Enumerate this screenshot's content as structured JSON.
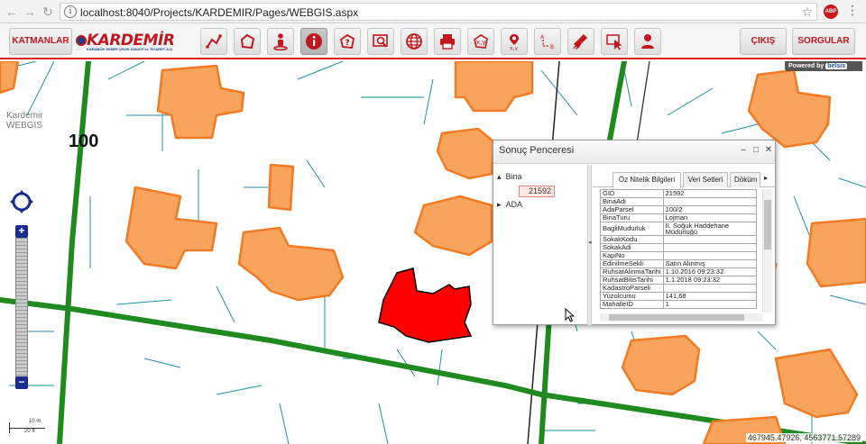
{
  "browser": {
    "url": "localhost:8040/Projects/KARDEMIR/Pages/WEBGIS.aspx",
    "abp_label": "ABP"
  },
  "toolbar": {
    "layers_label": "KATMANLAR",
    "logo_text": "KARDEMİR",
    "logo_subtitle": "KARABÜK DEMİR ÇELİK SANAYİ ve TİCARET A.Ş.",
    "exit_label": "ÇIKIŞ",
    "queries_label": "SORGULAR",
    "accent": "#c0181e"
  },
  "map": {
    "powered_prefix": "Powered by",
    "powered_brand": "belsis",
    "label_line1": "Kardemir",
    "label_line2": "WEBGIS",
    "scale_text": "100",
    "coords": "467945.47926, 4563771.57289",
    "scalebar_m": "10 m",
    "scalebar_ft": "20 ft",
    "building_fill": "#f9a45c",
    "selected_fill": "#ff0000",
    "road_color": "#1f8a1f"
  },
  "window": {
    "title": "Sonuç Penceresi",
    "tree_root": "Bina",
    "tree_selected": "21592",
    "tree_other": "ADA",
    "tabs": [
      "Öz Nitelik Bilgileri",
      "Veri Setleri",
      "Döküm"
    ],
    "rows": [
      [
        "GID",
        "21592"
      ],
      [
        "BinaAdi",
        ""
      ],
      [
        "AdaParsel",
        "100/2"
      ],
      [
        "BinaTuru",
        "Lojman"
      ],
      [
        "BagliMudurluk",
        "II. Soğuk Haddehane Müdürlüğü"
      ],
      [
        "SokakKodu",
        ""
      ],
      [
        "SokakAdi",
        ""
      ],
      [
        "KapiNo",
        ""
      ],
      [
        "EdinilmeSekli",
        "Satın Alınmış"
      ],
      [
        "RuhsatAlinmaTarihi",
        "1.10.2016 09:23:32"
      ],
      [
        "RuhsatBitisTarihi",
        "1.1.2018 09:23:32"
      ],
      [
        "KadastroParseli",
        ""
      ],
      [
        "Yuzolcumu",
        "141,68"
      ],
      [
        "MahalleID",
        "1"
      ]
    ]
  }
}
